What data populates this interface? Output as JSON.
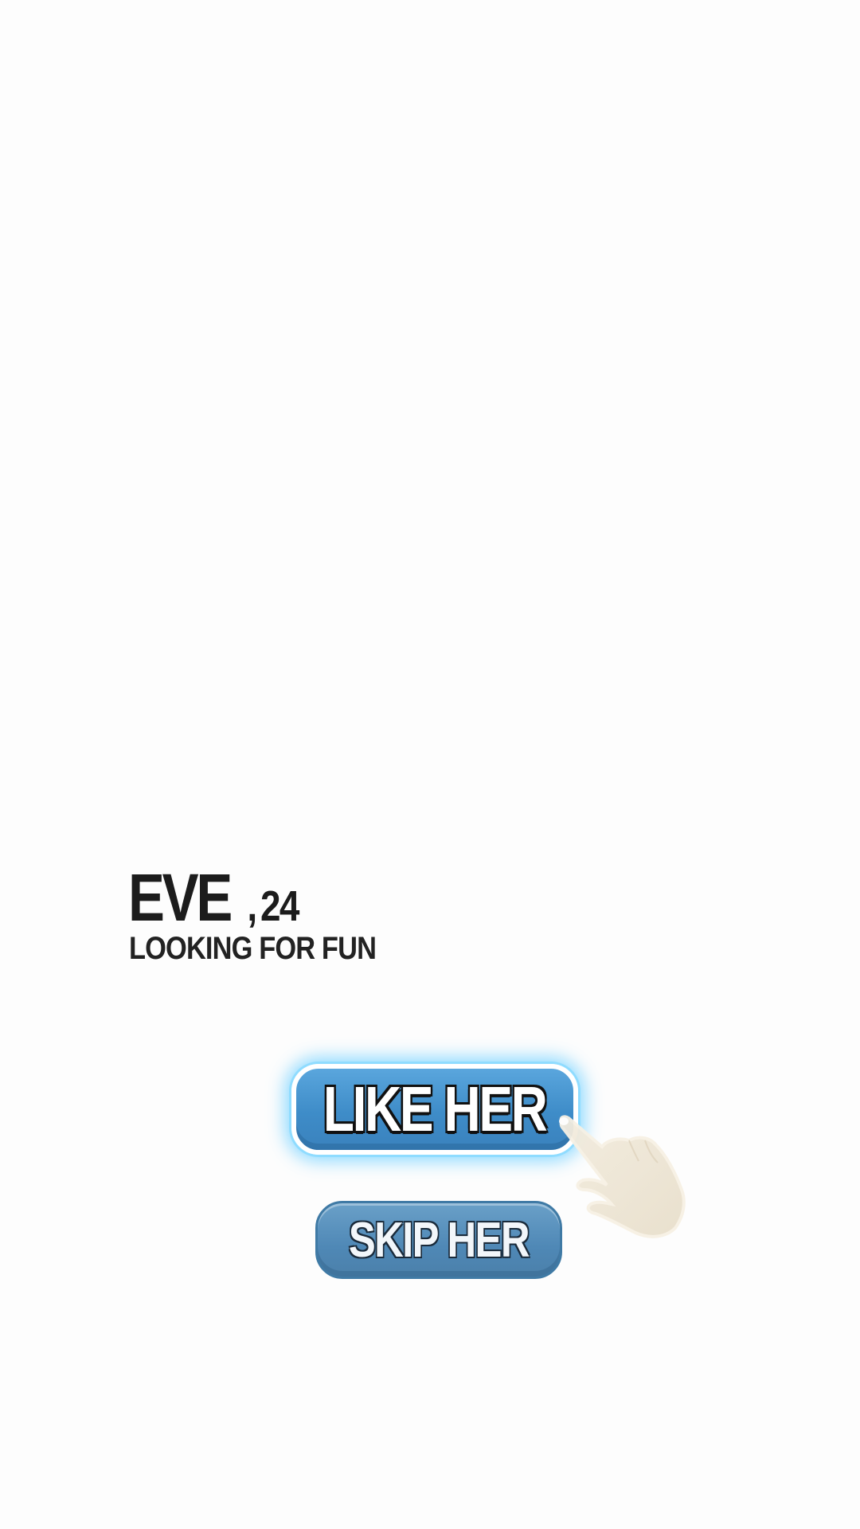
{
  "profile": {
    "name": "EVE",
    "comma": ",",
    "age": "24",
    "tagline": "LOOKING FOR FUN"
  },
  "buttons": {
    "like_label": "LIKE HER",
    "skip_label": "SKIP HER"
  },
  "icons": {
    "tutorial_hint": "hand-pointer-icon"
  },
  "colors": {
    "background": "#fdfdfd",
    "text": "#1c1c1c",
    "button_blue": "#4a96d2",
    "button_glow": "#8fdcff",
    "skip_blue": "#5a90bc",
    "hand": "#efe6d6"
  }
}
